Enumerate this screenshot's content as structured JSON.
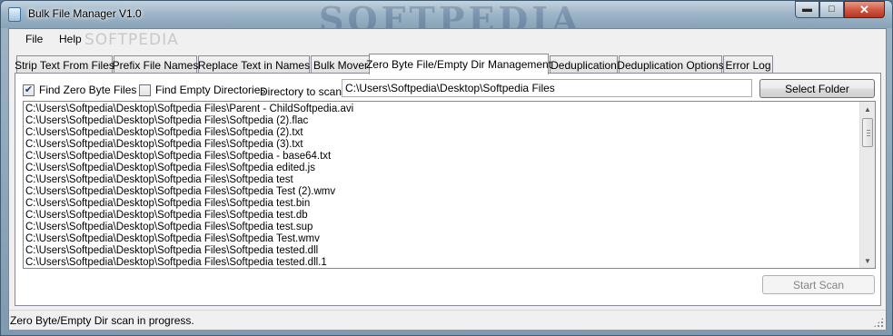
{
  "window": {
    "title": "Bulk File Manager V1.0",
    "watermark": "SOFTPEDIA",
    "menu_watermark": "SOFTPEDIA"
  },
  "menu": [
    "File",
    "Help"
  ],
  "tabs": [
    {
      "label": "Strip Text From Files",
      "active": false
    },
    {
      "label": "Prefix File Names",
      "active": false
    },
    {
      "label": "Replace Text in Names",
      "active": false
    },
    {
      "label": "Bulk Mover",
      "active": false
    },
    {
      "label": "Zero Byte File/Empty Dir Management",
      "active": true
    },
    {
      "label": "Deduplication",
      "active": false
    },
    {
      "label": "Deduplication Options",
      "active": false
    },
    {
      "label": "Error Log",
      "active": false
    }
  ],
  "options": {
    "find_zero_byte_label": "Find Zero Byte Files",
    "find_zero_byte_checked": true,
    "find_empty_dirs_label": "Find Empty Directories",
    "find_empty_dirs_checked": false
  },
  "directory": {
    "label": "Directory to scan:",
    "value": "C:\\Users\\Softpedia\\Desktop\\Softpedia Files"
  },
  "buttons": {
    "select_folder": "Select Folder",
    "start_scan": "Start Scan"
  },
  "results": [
    "C:\\Users\\Softpedia\\Desktop\\Softpedia Files\\Parent - ChildSoftpedia.avi",
    "C:\\Users\\Softpedia\\Desktop\\Softpedia Files\\Softpedia (2).flac",
    "C:\\Users\\Softpedia\\Desktop\\Softpedia Files\\Softpedia (2).txt",
    "C:\\Users\\Softpedia\\Desktop\\Softpedia Files\\Softpedia (3).txt",
    "C:\\Users\\Softpedia\\Desktop\\Softpedia Files\\Softpedia - base64.txt",
    "C:\\Users\\Softpedia\\Desktop\\Softpedia Files\\Softpedia edited.js",
    "C:\\Users\\Softpedia\\Desktop\\Softpedia Files\\Softpedia test",
    "C:\\Users\\Softpedia\\Desktop\\Softpedia Files\\Softpedia Test (2).wmv",
    "C:\\Users\\Softpedia\\Desktop\\Softpedia Files\\Softpedia test.bin",
    "C:\\Users\\Softpedia\\Desktop\\Softpedia Files\\Softpedia test.db",
    "C:\\Users\\Softpedia\\Desktop\\Softpedia Files\\Softpedia test.sup",
    "C:\\Users\\Softpedia\\Desktop\\Softpedia Files\\Softpedia Test.wmv",
    "C:\\Users\\Softpedia\\Desktop\\Softpedia Files\\Softpedia tested.dll",
    "C:\\Users\\Softpedia\\Desktop\\Softpedia Files\\Softpedia tested.dll.1"
  ],
  "status": "Zero Byte/Empty Dir scan in progress."
}
